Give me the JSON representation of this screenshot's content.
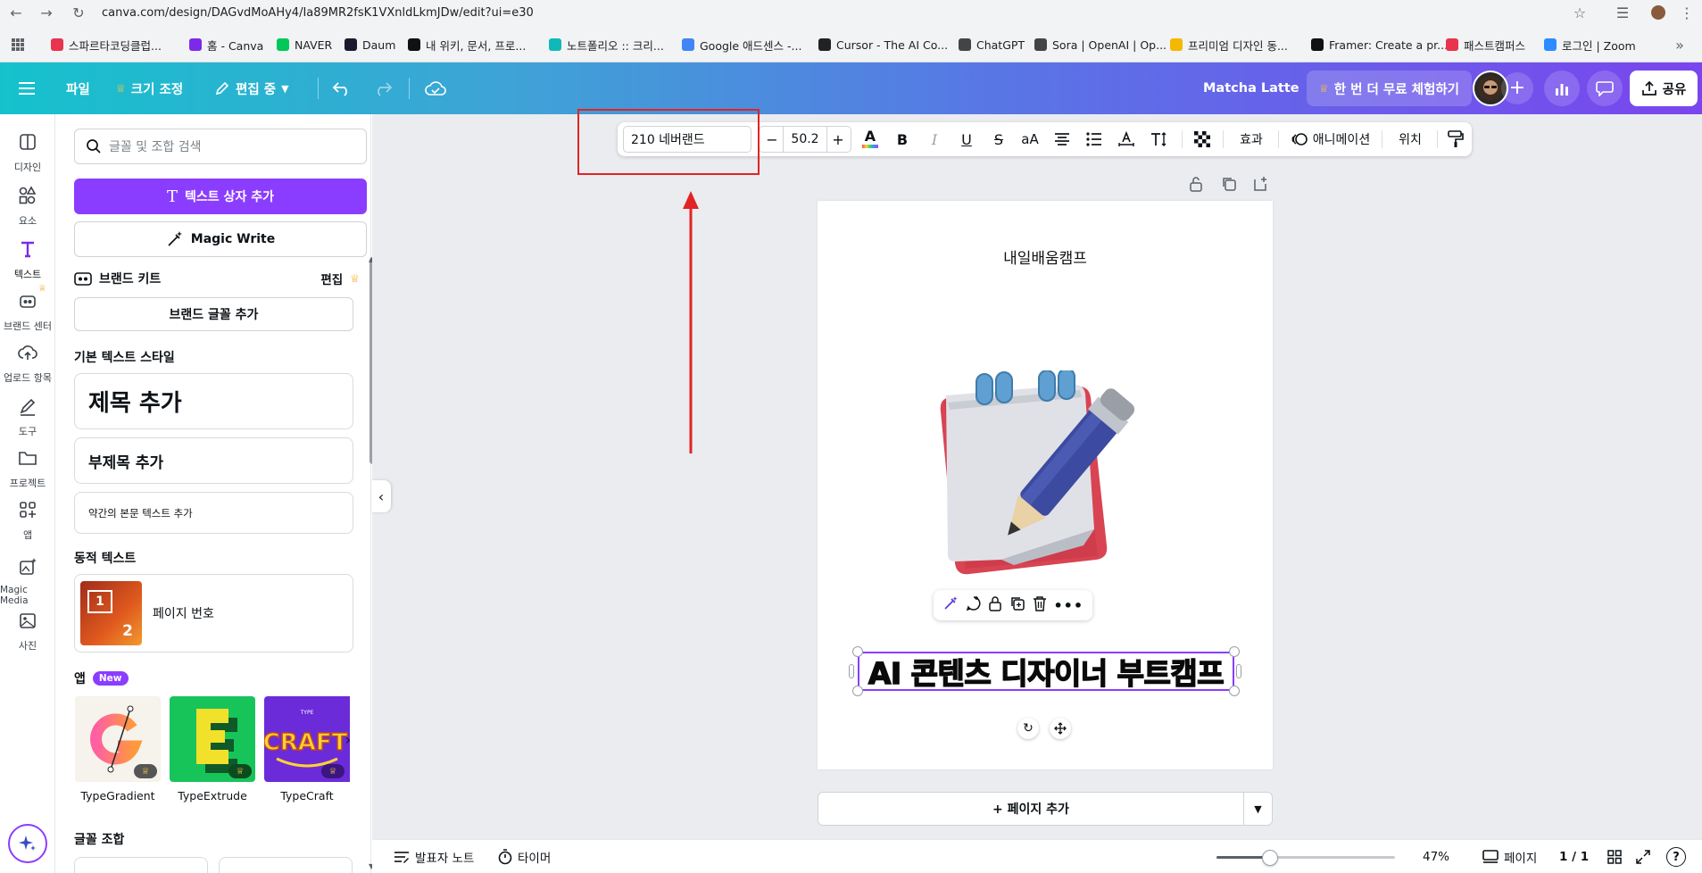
{
  "browser": {
    "url": "canva.com/design/DAGvdMoAHy4/Ia89MR2fsK1VXnldLkmJDw/edit?ui=e30",
    "bookmarks": [
      {
        "label": "스파르타코딩클럽...",
        "color": "#e8344e"
      },
      {
        "label": "홈 - Canva",
        "color": "#7d2ae8"
      },
      {
        "label": "NAVER",
        "color": "#03c75a"
      },
      {
        "label": "Daum",
        "color": "#1a1a2e"
      },
      {
        "label": "내 위키, 문서, 프로...",
        "color": "#111111"
      },
      {
        "label": "노트폴리오 :: 크리...",
        "color": "#11b8b8"
      },
      {
        "label": "Google 애드센스 -...",
        "color": "#4285f4"
      },
      {
        "label": "Cursor - The AI Co...",
        "color": "#222222"
      },
      {
        "label": "ChatGPT",
        "color": "#444444"
      },
      {
        "label": "Sora | OpenAI | Op...",
        "color": "#444444"
      },
      {
        "label": "프리미엄 디자인 동...",
        "color": "#f5b800"
      },
      {
        "label": "Framer: Create a pr...",
        "color": "#111111"
      },
      {
        "label": "패스트캠퍼스",
        "color": "#e8344e"
      },
      {
        "label": "로그인 | Zoom",
        "color": "#2d8cff"
      }
    ]
  },
  "header": {
    "file": "파일",
    "resize": "크기 조정",
    "editing": "편집 중",
    "design_title": "Matcha Latte",
    "trial": "한 번 더 무료 체험하기",
    "share": "공유"
  },
  "rail": [
    {
      "label": "디자인",
      "icon": "design-icon"
    },
    {
      "label": "요소",
      "icon": "elements-icon"
    },
    {
      "label": "텍스트",
      "icon": "text-icon"
    },
    {
      "label": "브랜드 센터",
      "icon": "brand-icon"
    },
    {
      "label": "업로드 항목",
      "icon": "upload-icon"
    },
    {
      "label": "도구",
      "icon": "draw-icon"
    },
    {
      "label": "프로젝트",
      "icon": "folder-icon"
    },
    {
      "label": "앱",
      "icon": "apps-icon"
    },
    {
      "label": "Magic Media",
      "icon": "magic-media-icon"
    },
    {
      "label": "사진",
      "icon": "photo-icon"
    }
  ],
  "panel": {
    "search_placeholder": "글꼴 및 조합 검색",
    "add_textbox": "텍스트 상자 추가",
    "magic_write": "Magic Write",
    "brand_kit": "브랜드 키트",
    "brand_edit": "편집",
    "add_brand_font": "브랜드 글꼴 추가",
    "default_styles": "기본 텍스트 스타일",
    "heading": "제목 추가",
    "subheading": "부제목 추가",
    "body": "약간의 본문 텍스트 추가",
    "dynamic_text": "동적 텍스트",
    "page_number": "페이지 번호",
    "apps_title": "앱",
    "new_badge": "New",
    "apps": [
      "TypeGradient",
      "TypeExtrude",
      "TypeCraft"
    ],
    "font_combos": "글꼴 조합"
  },
  "toolbar": {
    "font": "210 네버랜드",
    "font_size": "50.2",
    "effects": "효과",
    "animate": "애니메이션",
    "position": "위치"
  },
  "canvas": {
    "brand_text": "내일배움캠프",
    "headline": "AI 콘텐츠 디자이너 부트캠프",
    "add_page": "+ 페이지 추가"
  },
  "bottom": {
    "notes": "발표자 노트",
    "timer": "타이머",
    "zoom": "47%",
    "zoom_fraction": 0.47,
    "pages_label": "페이지",
    "page_count": "1 / 1"
  },
  "colors": {
    "accent": "#8b3dff",
    "highlight_box": "#e02424"
  }
}
